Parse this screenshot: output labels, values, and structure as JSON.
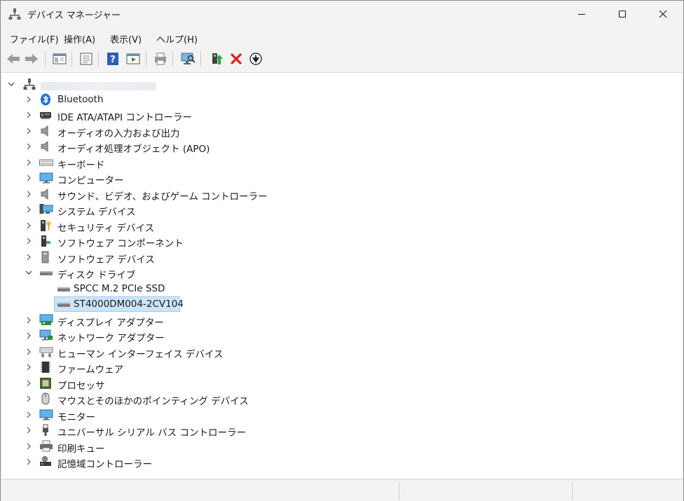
{
  "window": {
    "title": "デバイス マネージャー"
  },
  "menu": [
    {
      "id": "file",
      "label": "ファイル(F)"
    },
    {
      "id": "action",
      "label": "操作(A)"
    },
    {
      "id": "view",
      "label": "表示(V)"
    },
    {
      "id": "help",
      "label": "ヘルプ(H)"
    }
  ],
  "toolbar": [
    {
      "id": "back",
      "icon": "arrow-left-icon",
      "enabled": false
    },
    {
      "id": "forward",
      "icon": "arrow-right-icon",
      "enabled": false
    },
    {
      "id": "show-hide-console-tree",
      "icon": "console-tree-icon"
    },
    {
      "id": "properties",
      "icon": "properties-icon"
    },
    {
      "id": "help",
      "icon": "help-icon"
    },
    {
      "id": "action-pane",
      "icon": "action-pane-icon"
    },
    {
      "id": "print",
      "icon": "print-icon"
    },
    {
      "id": "scan-hardware",
      "icon": "scan-hardware-icon"
    },
    {
      "id": "update-driver",
      "icon": "update-driver-icon"
    },
    {
      "id": "uninstall-device",
      "icon": "uninstall-icon"
    },
    {
      "id": "disable-device",
      "icon": "disable-icon"
    }
  ],
  "tree": {
    "root": {
      "label": "",
      "expanded": true,
      "icon": "computer-root-icon"
    },
    "nodes": [
      {
        "label": "Bluetooth",
        "icon": "bluetooth-icon",
        "expanded": false
      },
      {
        "label": "IDE ATA/ATAPI コントローラー",
        "icon": "ide-controller-icon",
        "expanded": false
      },
      {
        "label": "オーディオの入力および出力",
        "icon": "speaker-icon",
        "expanded": false
      },
      {
        "label": "オーディオ処理オブジェクト (APO)",
        "icon": "speaker-icon",
        "expanded": false
      },
      {
        "label": "キーボード",
        "icon": "keyboard-icon",
        "expanded": false
      },
      {
        "label": "コンピューター",
        "icon": "monitor-icon",
        "expanded": false
      },
      {
        "label": "サウンド、ビデオ、およびゲーム コントローラー",
        "icon": "speaker-icon",
        "expanded": false
      },
      {
        "label": "システム デバイス",
        "icon": "system-device-icon",
        "expanded": false
      },
      {
        "label": "セキュリティ デバイス",
        "icon": "security-device-icon",
        "expanded": false
      },
      {
        "label": "ソフトウェア コンポーネント",
        "icon": "software-component-icon",
        "expanded": false
      },
      {
        "label": "ソフトウェア デバイス",
        "icon": "software-device-icon",
        "expanded": false
      },
      {
        "label": "ディスク ドライブ",
        "icon": "disk-drive-icon",
        "expanded": true,
        "children": [
          {
            "label": "SPCC M.2 PCIe SSD",
            "icon": "disk-drive-icon",
            "selected": false
          },
          {
            "label": "ST4000DM004-2CV104",
            "icon": "disk-drive-icon",
            "selected": true
          }
        ]
      },
      {
        "label": "ディスプレイ アダプター",
        "icon": "display-adapter-icon",
        "expanded": false
      },
      {
        "label": "ネットワーク アダプター",
        "icon": "network-adapter-icon",
        "expanded": false
      },
      {
        "label": "ヒューマン インターフェイス デバイス",
        "icon": "hid-icon",
        "expanded": false
      },
      {
        "label": "ファームウェア",
        "icon": "firmware-icon",
        "expanded": false
      },
      {
        "label": "プロセッサ",
        "icon": "processor-icon",
        "expanded": false
      },
      {
        "label": "マウスとそのほかのポインティング デバイス",
        "icon": "mouse-icon",
        "expanded": false
      },
      {
        "label": "モニター",
        "icon": "monitor-icon",
        "expanded": false
      },
      {
        "label": "ユニバーサル シリアル バス コントローラー",
        "icon": "usb-icon",
        "expanded": false
      },
      {
        "label": "印刷キュー",
        "icon": "printer-icon",
        "expanded": false
      },
      {
        "label": "記憶域コントローラー",
        "icon": "storage-controller-icon",
        "expanded": false
      }
    ]
  },
  "colors": {
    "chrome_bg": "#f3f3f3",
    "selection_bg": "#cce4f7",
    "selection_border": "#99c9ef",
    "delete_red": "#e0201b"
  }
}
